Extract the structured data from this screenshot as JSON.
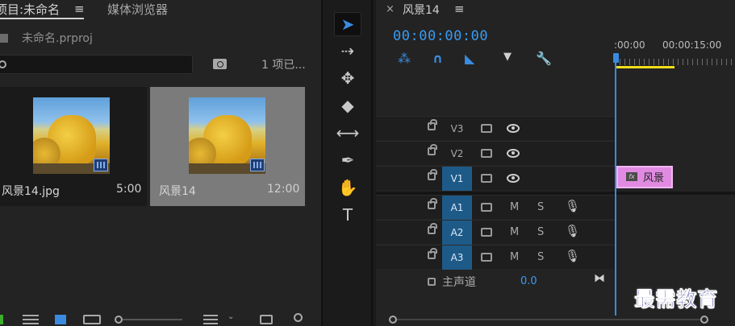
{
  "project_panel": {
    "tab_active": "项目:未命名",
    "tab_menu": "≡",
    "tab_inactive": "媒体浏览器",
    "file_name": "未命名.prproj",
    "search_placeholder": "",
    "items_count": "1 项已...",
    "items": [
      {
        "name": "风景14.jpg",
        "duration": "5:00",
        "selected": false
      },
      {
        "name": "风景14",
        "duration": "12:00",
        "selected": true
      }
    ]
  },
  "tools": [
    {
      "name": "selection-tool",
      "glyph": "➤",
      "selected": true
    },
    {
      "name": "track-select-forward-tool",
      "glyph": "⇢"
    },
    {
      "name": "ripple-edit-tool",
      "glyph": "✥"
    },
    {
      "name": "razor-tool",
      "glyph": "◆"
    },
    {
      "name": "slip-tool",
      "glyph": "⟷"
    },
    {
      "name": "pen-tool",
      "glyph": "✒"
    },
    {
      "name": "hand-tool",
      "glyph": "✋"
    },
    {
      "name": "type-tool",
      "glyph": "T"
    }
  ],
  "timeline": {
    "close": "×",
    "title": "风景14",
    "menu": "≡",
    "timecode": "00:00:00:00",
    "ruler_labels": [
      ":00:00",
      "00:00:15:00"
    ],
    "video_tracks": [
      {
        "label": "V3",
        "targeted": false
      },
      {
        "label": "V2",
        "targeted": false
      },
      {
        "label": "V1",
        "targeted": true
      }
    ],
    "audio_tracks": [
      {
        "label": "A1",
        "m": "M",
        "s": "S"
      },
      {
        "label": "A2",
        "m": "M",
        "s": "S"
      },
      {
        "label": "A3",
        "m": "M",
        "s": "S"
      }
    ],
    "master_label": "主声道",
    "master_value": "0.0",
    "clip": {
      "fx": "fx",
      "name": "风景",
      "color": "#e08be1"
    }
  },
  "colors": {
    "accent_blue": "#3a8be0",
    "timecode_blue": "#3a9bf4",
    "work_area": "#f1df1a"
  },
  "watermark": "最需教育"
}
